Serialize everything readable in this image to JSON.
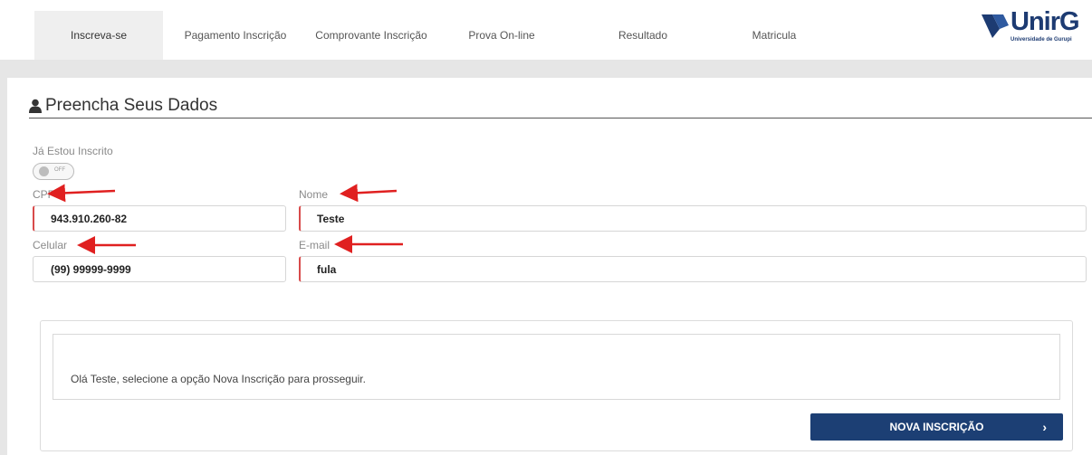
{
  "nav": {
    "tabs": [
      {
        "label": "Inscreva-se",
        "active": true
      },
      {
        "label": "Pagamento Inscrição"
      },
      {
        "label": "Comprovante Inscrição"
      },
      {
        "label": "Prova On-line"
      },
      {
        "label": "Resultado"
      },
      {
        "label": "Matricula"
      }
    ]
  },
  "logo": {
    "text": "UnirG",
    "subtitle": "Universidade de Gurupi"
  },
  "form": {
    "title": "Preencha Seus Dados",
    "registered_label": "Já Estou Inscrito",
    "toggle_state": "OFF",
    "cpf_label": "CPF",
    "cpf_value": "943.910.260-82",
    "nome_label": "Nome",
    "nome_value": "Teste",
    "celular_label": "Celular",
    "celular_value": "(99) 99999-9999",
    "email_label": "E-mail",
    "email_value": "fula"
  },
  "message": "Olá Teste, selecione a opção Nova Inscrição para prosseguir.",
  "button": {
    "label": "NOVA INSCRIÇÃO",
    "chevron": "›"
  },
  "colors": {
    "brand": "#1c3f74",
    "annotation": "#e02020",
    "required": "#d84a4a"
  }
}
